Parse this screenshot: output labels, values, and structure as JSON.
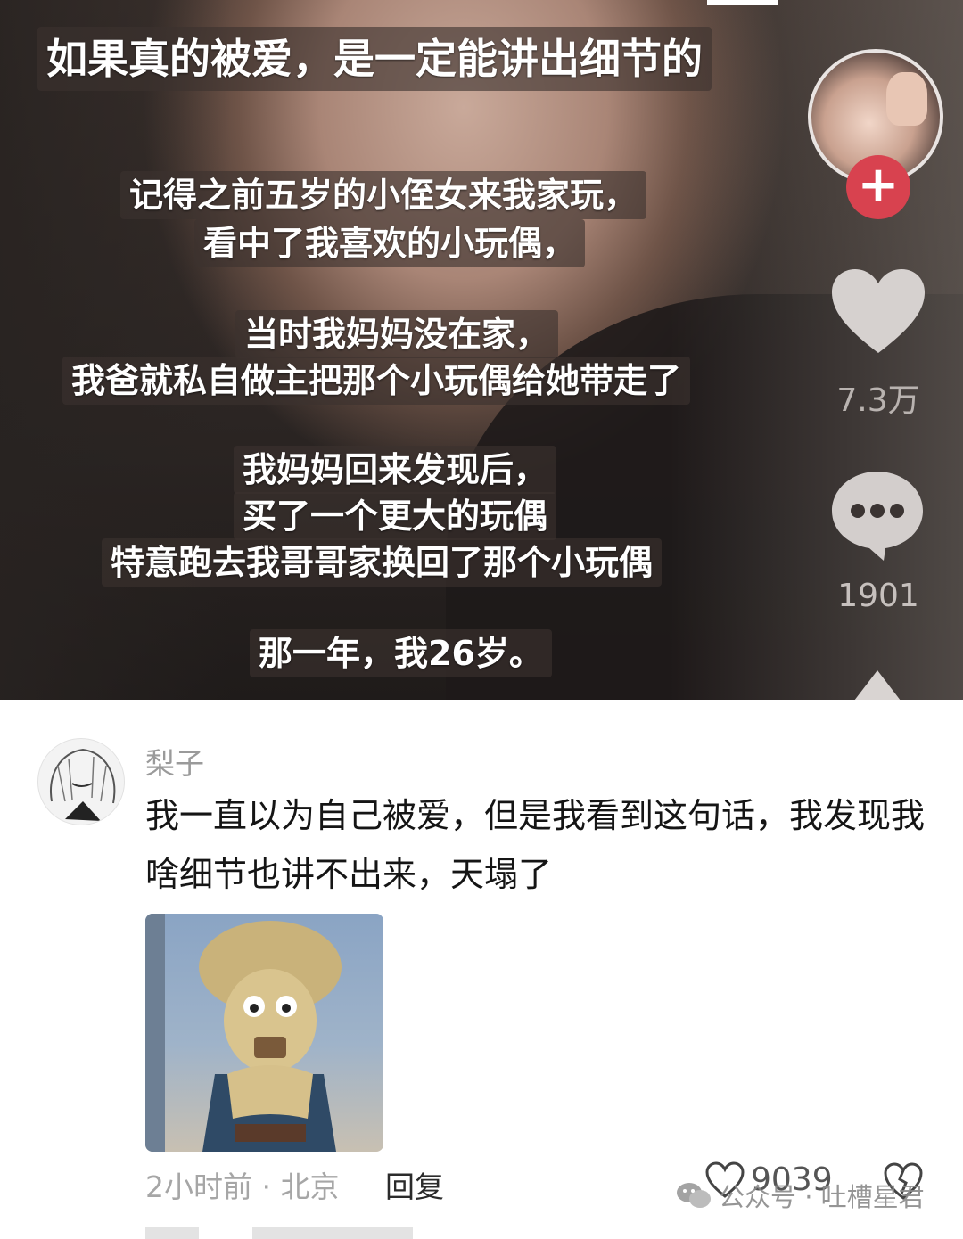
{
  "video": {
    "caption_title": "如果真的被爱，是一定能讲出细节的",
    "caption_lines": [
      "记得之前五岁的小侄女来我家玩，",
      "看中了我喜欢的小玩偶，",
      "当时我妈妈没在家，",
      "我爸就私自做主把那个小玩偶给她带走了",
      "我妈妈回来发现后，",
      "买了一个更大的玩偶",
      "特意跑去我哥哥家换回了那个小玩偶",
      "那一年，我26岁。"
    ],
    "follow_symbol": "+",
    "like_count": "7.3万",
    "comment_count": "1901"
  },
  "comment": {
    "username": "梨子",
    "text": "我一直以为自己被爱，但是我看到这句话，我发现我啥细节也讲不出来，天塌了",
    "meta": "2小时前 · 北京",
    "reply_label": "回复",
    "like_count": "9039"
  },
  "watermark": {
    "text": "公众号 · 吐槽星君"
  },
  "colors": {
    "follow_red": "#d8424f",
    "text_dark": "#151515",
    "text_gray": "#9a9a9a"
  },
  "icons": [
    "heart-icon",
    "comment-bubble-icon",
    "share-arrow-icon",
    "like-outline-icon",
    "dislike-icon",
    "wechat-icon"
  ]
}
